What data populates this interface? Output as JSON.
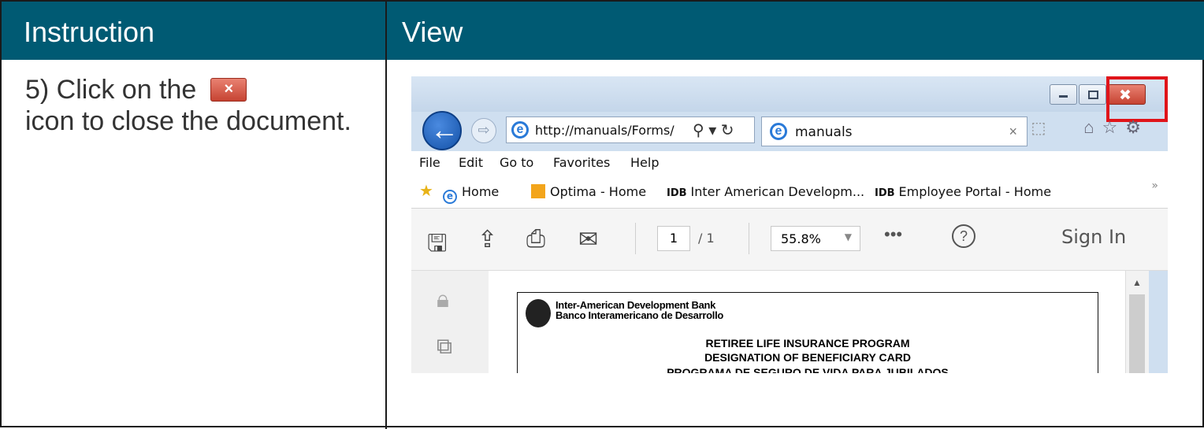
{
  "header": {
    "col1": "Instruction",
    "col2": "View"
  },
  "instruction": {
    "part1": "5) Click on the",
    "part2": "icon  to close the document."
  },
  "browser": {
    "address_url": "http://manuals/Forms/",
    "tab_title": "manuals",
    "menu": [
      "File",
      "Edit",
      "Go to",
      "Favorites",
      "Help"
    ],
    "favorites": [
      {
        "label": "Home"
      },
      {
        "label": "Optima - Home"
      },
      {
        "badge": "IDB",
        "label": "Inter American Developm..."
      },
      {
        "badge": "IDB",
        "label": "Employee Portal - Home"
      }
    ],
    "pdf_toolbar": {
      "page_current": "1",
      "page_total": "/ 1",
      "zoom": "55.8%",
      "more": "•••",
      "help": "?",
      "sign_in": "Sign In"
    },
    "document": {
      "bank_en": "Inter-American Development Bank",
      "bank_es": "Banco Interamericano de Desarrollo",
      "title1": "RETIREE LIFE INSURANCE PROGRAM",
      "title2": "DESIGNATION OF BENEFICIARY CARD",
      "title3": "PROGRAMA DE SEGURO DE VIDA PARA JUBILADOS"
    }
  },
  "colors": {
    "header_bg": "#005a73",
    "highlight": "#e0141a",
    "close_button": "#c64332"
  }
}
